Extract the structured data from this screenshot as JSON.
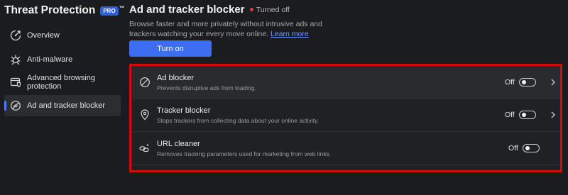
{
  "sidebar": {
    "title": "Threat Protection",
    "badge": "PRO",
    "trademark": "™",
    "items": [
      {
        "label": "Overview",
        "icon": "overview-icon"
      },
      {
        "label": "Anti-malware",
        "icon": "virus-icon"
      },
      {
        "label": "Advanced browsing protection",
        "icon": "browser-shield-icon"
      },
      {
        "label": "Ad and tracker blocker",
        "icon": "ad-block-icon",
        "active": true
      }
    ]
  },
  "main": {
    "title": "Ad and tracker blocker",
    "status": "Turned off",
    "description": "Browse faster and more privately without intrusive ads and trackers watching your every move online.",
    "learn_more": "Learn more",
    "turn_on_label": "Turn on"
  },
  "features": [
    {
      "title": "Ad blocker",
      "subtitle": "Prevents disruptive ads from loading.",
      "state": "Off",
      "icon": "ad-block-icon",
      "has_chevron": true
    },
    {
      "title": "Tracker blocker",
      "subtitle": "Stops trackers from collecting data about your online activity.",
      "state": "Off",
      "icon": "location-pin-icon",
      "has_chevron": true
    },
    {
      "title": "URL cleaner",
      "subtitle": "Removes tracking parameters used for marketing from web links.",
      "state": "Off",
      "icon": "link-clean-icon",
      "has_chevron": false
    }
  ],
  "colors": {
    "accent": "#3d6ef2",
    "highlight_border": "#d50b0b",
    "status_off": "#e23a3a"
  }
}
